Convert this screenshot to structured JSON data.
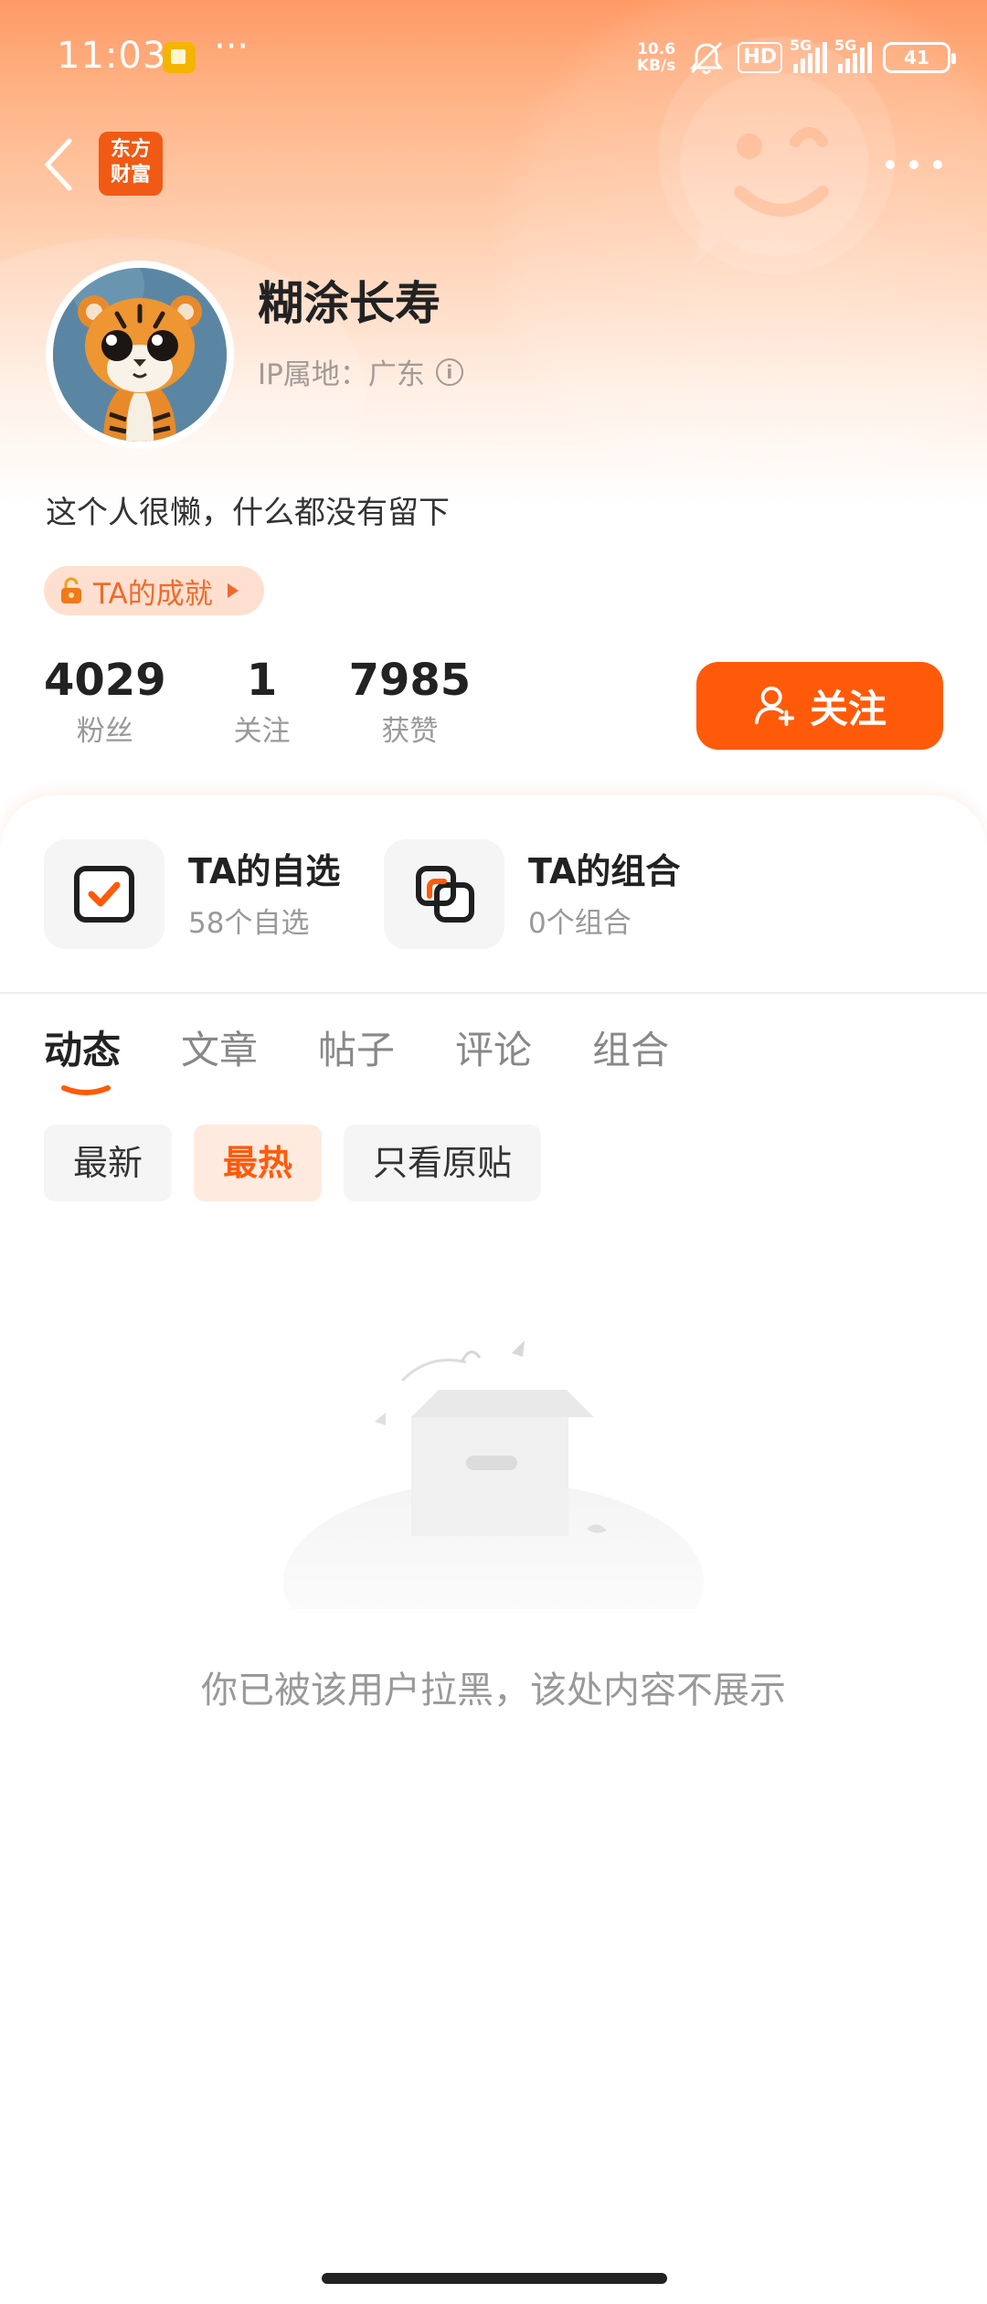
{
  "status_bar": {
    "time": "11:03",
    "more_indicator": "···",
    "net_speed_value": "10.6",
    "net_speed_unit": "KB/s",
    "hd_label": "HD",
    "network_1": "5G",
    "network_2": "5G",
    "battery": "41"
  },
  "nav": {
    "logo_line1": "东方",
    "logo_line2": "财富"
  },
  "profile": {
    "nickname": "糊涂长寿",
    "ip_location": "IP属地：广东",
    "bio": "这个人很懒，什么都没有留下",
    "achievement_label": "TA的成就"
  },
  "stats": [
    {
      "value": "4029",
      "label": "粉丝"
    },
    {
      "value": "1",
      "label": "关注"
    },
    {
      "value": "7985",
      "label": "获赞"
    }
  ],
  "follow_button": "关注",
  "favorites": {
    "watchlist_title": "TA的自选",
    "watchlist_sub": "58个自选",
    "portfolio_title": "TA的组合",
    "portfolio_sub": "0个组合"
  },
  "tabs": [
    "动态",
    "文章",
    "帖子",
    "评论",
    "组合"
  ],
  "active_tab": "动态",
  "filters": [
    "最新",
    "最热",
    "只看原贴"
  ],
  "active_filter": "最热",
  "empty_message": "你已被该用户拉黑，该处内容不展示",
  "colors": {
    "accent": "#ff5a0a",
    "logo": "#f05a14",
    "chip_active_bg": "#ffeadf"
  }
}
